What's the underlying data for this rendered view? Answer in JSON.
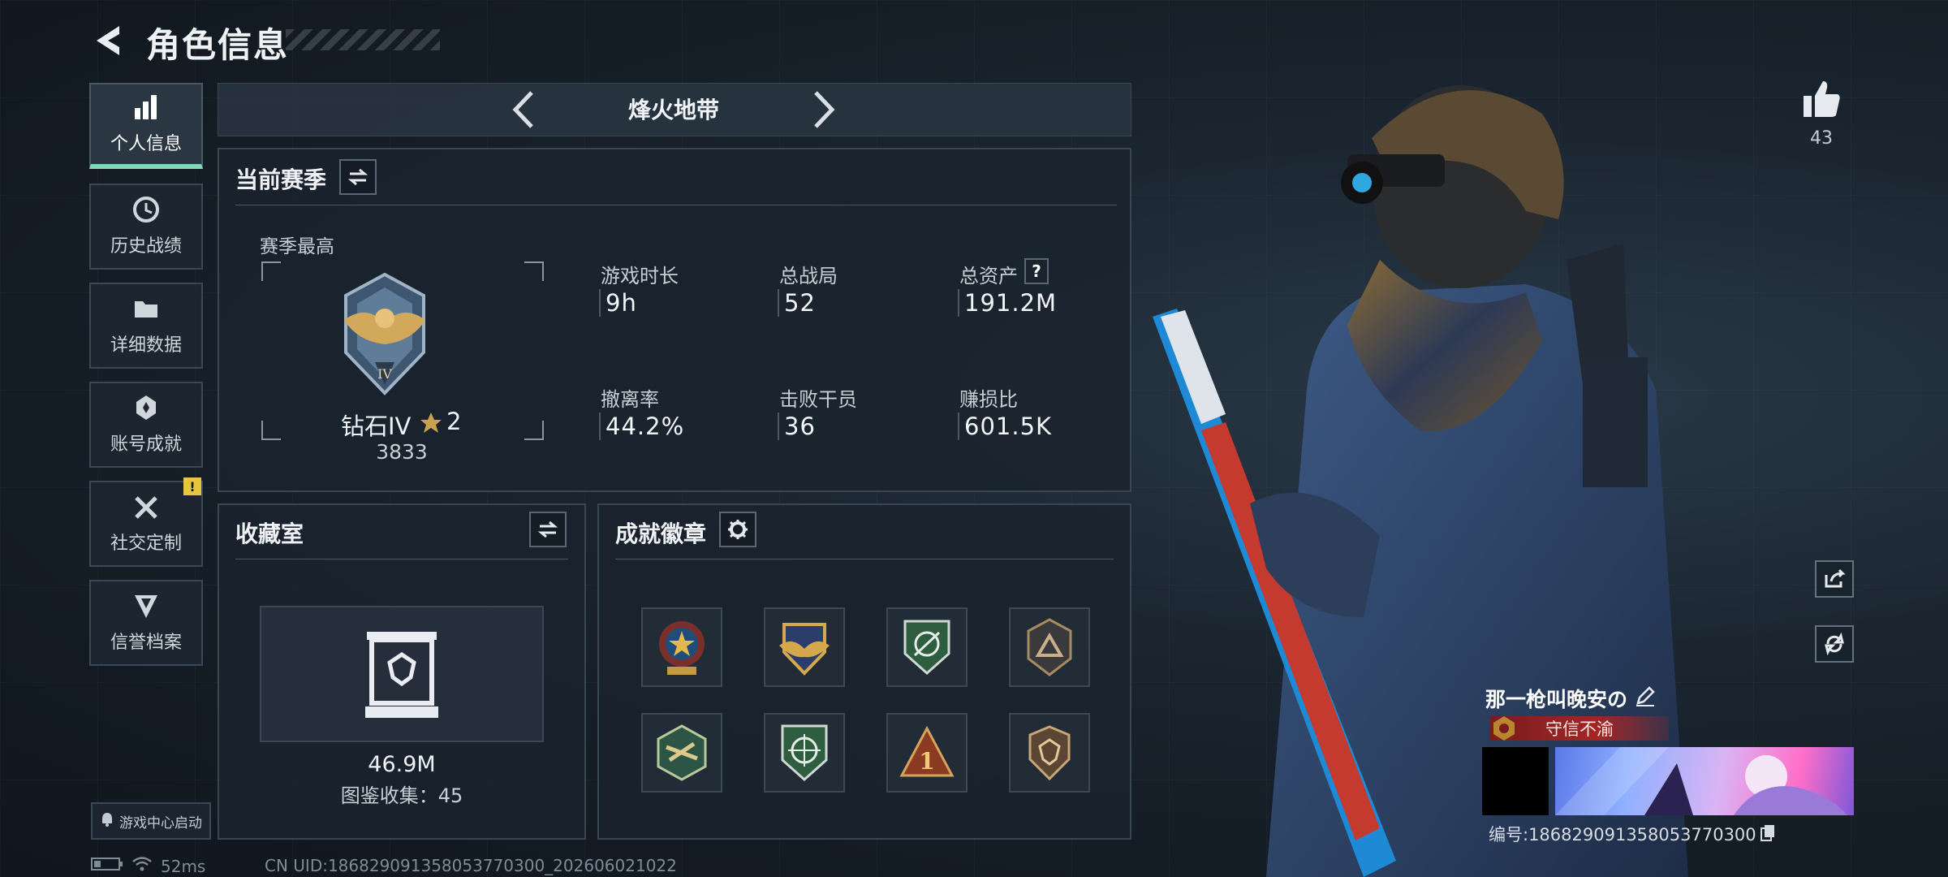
{
  "header": {
    "title": "角色信息"
  },
  "sidebar": {
    "items": [
      {
        "label": "个人信息",
        "active": true
      },
      {
        "label": "历史战绩"
      },
      {
        "label": "详细数据"
      },
      {
        "label": "账号成就"
      },
      {
        "label": "社交定制",
        "badge": "!"
      },
      {
        "label": "信誉档案"
      }
    ],
    "launch_label": "游戏中心启动"
  },
  "mode": {
    "title": "烽火地带"
  },
  "season": {
    "title": "当前赛季",
    "best_label": "赛季最高",
    "rank_name": "钻石IV",
    "rank_stars": "2",
    "rank_score": "3833",
    "stats": [
      {
        "label": "游戏时长",
        "value": "9h"
      },
      {
        "label": "总战局",
        "value": "52"
      },
      {
        "label": "总资产",
        "value": "191.2M",
        "help": "?"
      },
      {
        "label": "撤离率",
        "value": "44.2%"
      },
      {
        "label": "击败干员",
        "value": "36"
      },
      {
        "label": "赚损比",
        "value": "601.5K"
      }
    ]
  },
  "collection": {
    "title": "收藏室",
    "value": "46.9M",
    "count_text": "图鉴收集：45"
  },
  "achievements": {
    "title": "成就徽章",
    "badges": [
      "star-medal",
      "gold-wings-badge",
      "green-target-badge",
      "bronze-triangle-badge",
      "drone-hex-badge",
      "green-crosshair-badge",
      "number-one-badge",
      "bronze-crest-badge"
    ]
  },
  "profile": {
    "likes": "43",
    "nickname": "那一枪叫晚安の",
    "title_tag": "守信不渝",
    "uid_text": "编号:18682909135805377030​0"
  },
  "status": {
    "ping": "52ms",
    "cn_uid": "CN UID:18682909135805377030​0_202606021022"
  },
  "colors": {
    "accent": "#7fd9b7",
    "warning": "#e9c43f",
    "title_red": "#a32626"
  }
}
